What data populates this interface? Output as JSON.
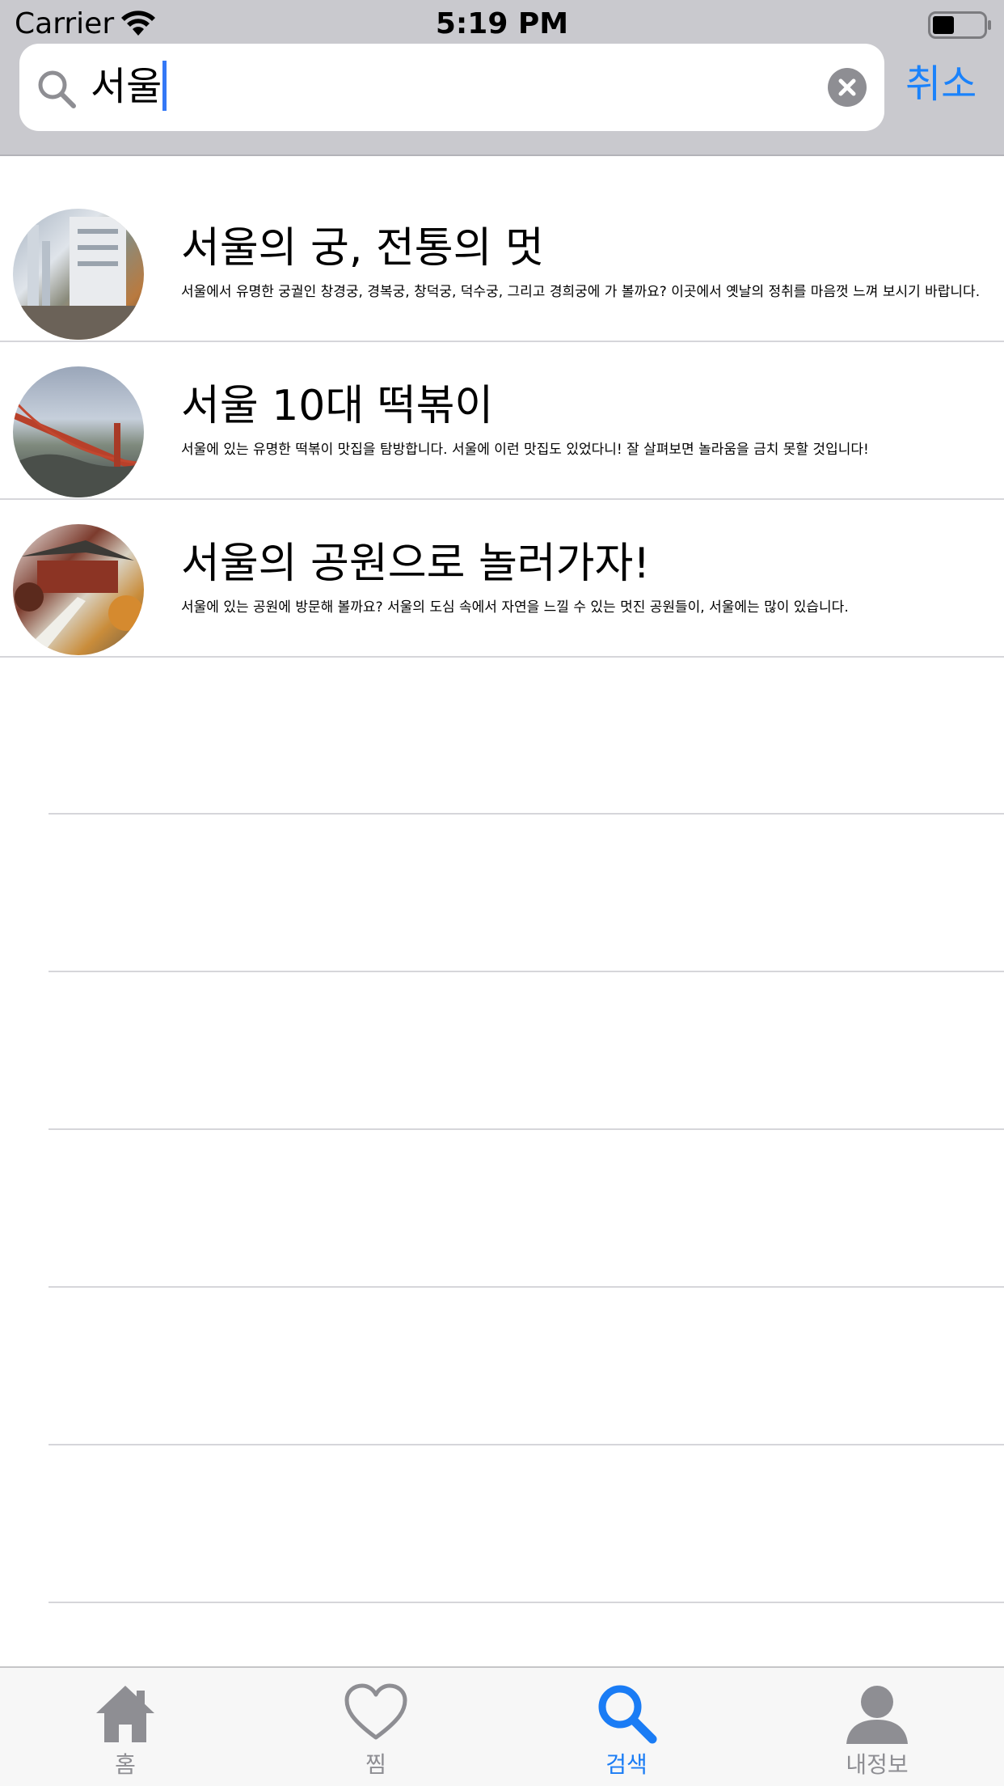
{
  "status_bar": {
    "carrier": "Carrier",
    "time": "5:19 PM",
    "wifi_icon": "wifi-icon",
    "battery_icon": "battery-icon"
  },
  "search": {
    "query": "서울",
    "cancel_label": "취소",
    "search_icon": "search-icon",
    "clear_icon": "clear-icon",
    "caret_color": "#3478f6"
  },
  "results": [
    {
      "title": "서울의 궁, 전통의 멋",
      "description": "서울에서 유명한 궁궐인 창경궁, 경복궁, 창덕궁, 덕수궁, 그리고 경희궁에 가 볼까요? 이곳에서 옛날의 정취를 마음껏 느껴 보시기 바랍니다."
    },
    {
      "title": "서울 10대 떡볶이",
      "description": "서울에 있는 유명한 떡볶이 맛집을 탐방합니다. 서울에 이런 맛집도 있었다니! 잘 살펴보면 놀라움을 금치 못할 것입니다!"
    },
    {
      "title": "서울의 공원으로 놀러가자!",
      "description": "서울에 있는 공원에 방문해 볼까요? 서울의 도심 속에서 자연을 느낄 수 있는 멋진 공원들이, 서울에는 많이 있습니다."
    }
  ],
  "tabbar": {
    "tabs": [
      {
        "label": "홈",
        "icon": "home-icon",
        "active": false
      },
      {
        "label": "찜",
        "icon": "heart-icon",
        "active": false
      },
      {
        "label": "검색",
        "icon": "search-icon",
        "active": true
      },
      {
        "label": "내정보",
        "icon": "person-icon",
        "active": false
      }
    ],
    "active_color": "#1a7cf5",
    "inactive_color": "#8e8e93"
  },
  "colors": {
    "header_bg": "#c9c9ce",
    "accent": "#1a82fb"
  }
}
